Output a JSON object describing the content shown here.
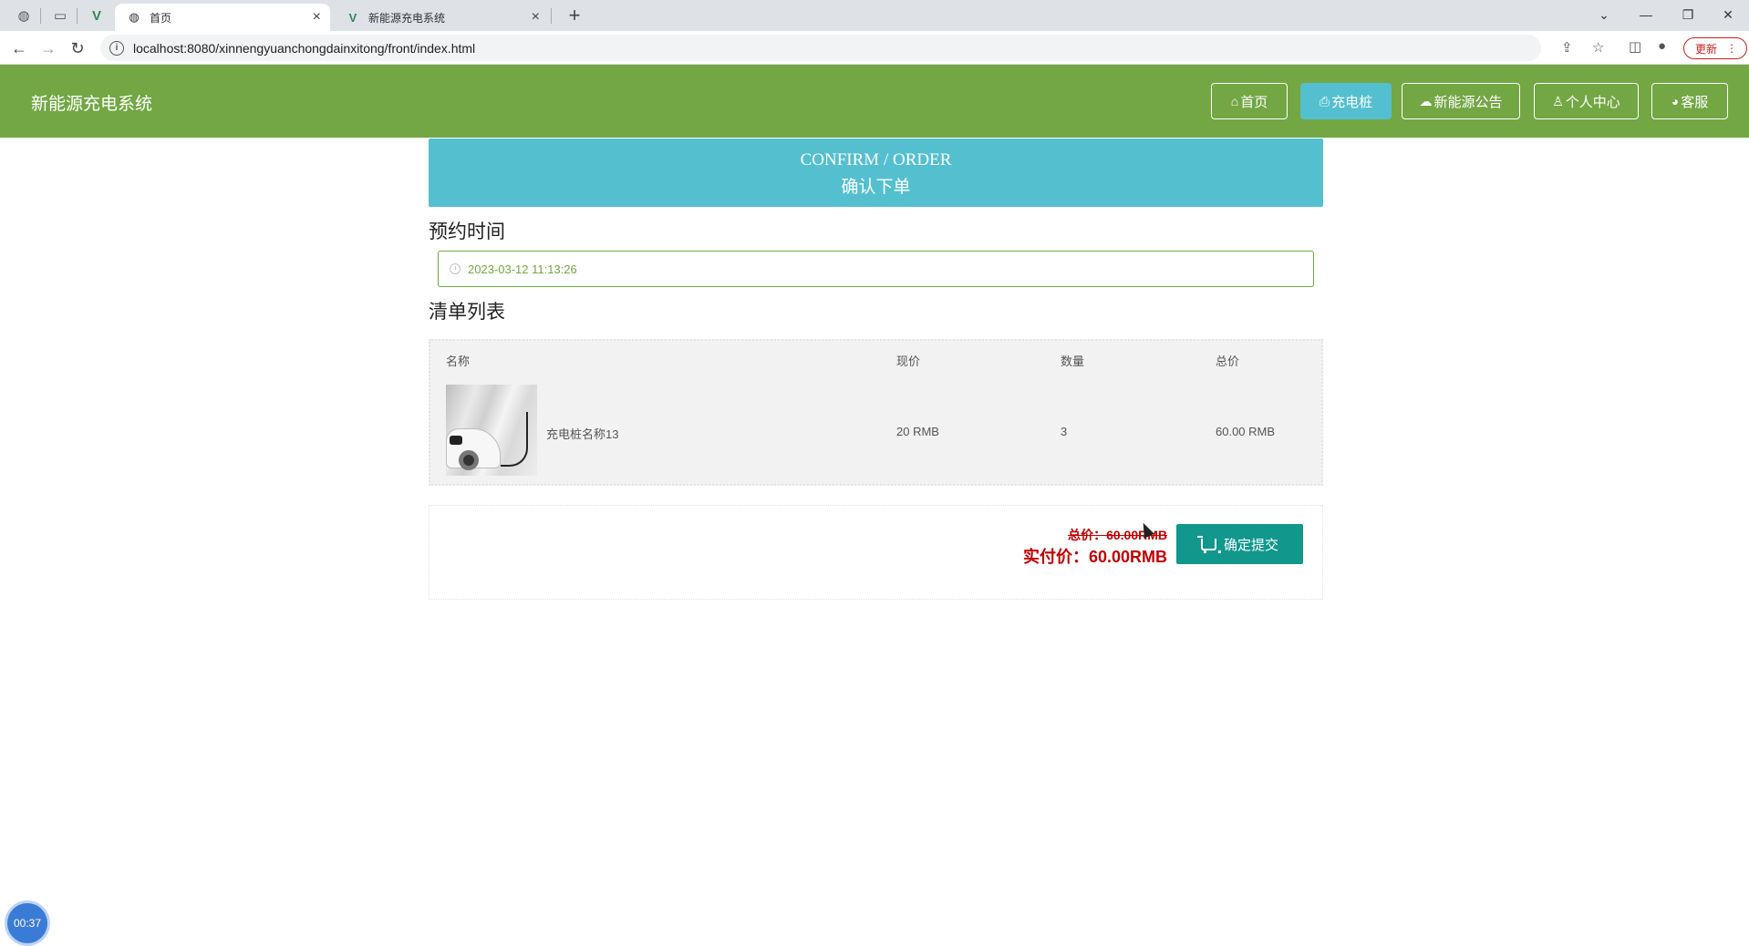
{
  "browser": {
    "tabs": [
      {
        "title": "首页",
        "active": true
      },
      {
        "title": "新能源充电系统",
        "active": false
      }
    ],
    "url": "localhost:8080/xinnengyuanchongdainxitong/front/index.html",
    "update_label": "更新"
  },
  "header": {
    "brand": "新能源充电系统",
    "nav": [
      {
        "label": "首页",
        "icon": "home-icon"
      },
      {
        "label": "充电桩",
        "icon": "printer-icon",
        "active": true
      },
      {
        "label": "新能源公告",
        "icon": "chat-icon"
      },
      {
        "label": "个人中心",
        "icon": "user-icon"
      },
      {
        "label": "客服",
        "icon": "service-icon"
      }
    ]
  },
  "banner": {
    "en": "CONFIRM / ORDER",
    "zh": "确认下单"
  },
  "booking": {
    "title": "预约时间",
    "time_value": "2023-03-12 11:13:26"
  },
  "list": {
    "title": "清单列表",
    "headers": {
      "name": "名称",
      "price": "现价",
      "qty": "数量",
      "total": "总价"
    },
    "rows": [
      {
        "name": "充电桩名称13",
        "price": "20 RMB",
        "qty": "3",
        "total": "60.00 RMB"
      }
    ]
  },
  "summary": {
    "total_label": "总价：60.00RMB",
    "paid_label": "实付价：60.00RMB",
    "submit_label": "确定提交"
  },
  "overlay": {
    "timer": "00:37"
  },
  "colors": {
    "header_bg": "#72a744",
    "banner_bg": "#54bfcf",
    "submit_bg": "#11978c",
    "price_red": "#c00000"
  }
}
